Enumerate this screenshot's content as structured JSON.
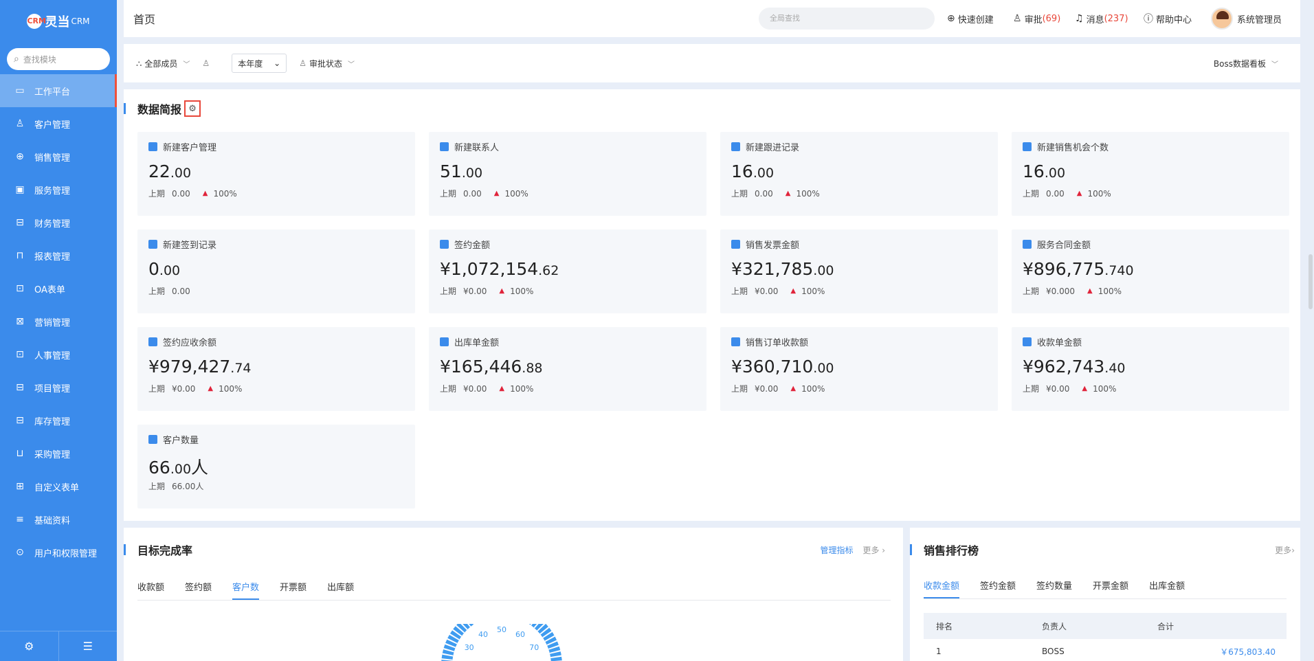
{
  "sidebar": {
    "logo_text": "灵当",
    "logo_suffix": "CRM",
    "logo_mark": "CRM",
    "search_placeholder": "查找模块",
    "items": [
      {
        "label": "工作平台",
        "icon": "monitor-icon",
        "glyph": "▭",
        "active": true
      },
      {
        "label": "客户管理",
        "icon": "user-icon",
        "glyph": "♙"
      },
      {
        "label": "销售管理",
        "icon": "target-icon",
        "glyph": "⊕"
      },
      {
        "label": "服务管理",
        "icon": "briefcase-icon",
        "glyph": "▣"
      },
      {
        "label": "财务管理",
        "icon": "wallet-icon",
        "glyph": "⊟"
      },
      {
        "label": "报表管理",
        "icon": "report-icon",
        "glyph": "⊓"
      },
      {
        "label": "OA表单",
        "icon": "stamp-icon",
        "glyph": "⊡"
      },
      {
        "label": "营销管理",
        "icon": "bookmark-icon",
        "glyph": "⊠"
      },
      {
        "label": "人事管理",
        "icon": "person-card-icon",
        "glyph": "⊡"
      },
      {
        "label": "项目管理",
        "icon": "project-icon",
        "glyph": "⊟"
      },
      {
        "label": "库存管理",
        "icon": "warehouse-icon",
        "glyph": "⊟"
      },
      {
        "label": "采购管理",
        "icon": "cart-icon",
        "glyph": "⊔"
      },
      {
        "label": "自定义表单",
        "icon": "grid-icon",
        "glyph": "⊞"
      },
      {
        "label": "基础资料",
        "icon": "document-icon",
        "glyph": "≡"
      },
      {
        "label": "用户和权限管理",
        "icon": "gear-circle-icon",
        "glyph": "⊙"
      }
    ],
    "footer_settings_glyph": "⚙",
    "footer_collapse_glyph": "☰"
  },
  "header": {
    "title": "首页",
    "global_search_placeholder": "全局查找",
    "quick_create": "快速创建",
    "approval": "审批",
    "approval_count": "(69)",
    "messages": "消息",
    "messages_count": "(237)",
    "help": "帮助中心",
    "user_name": "系统管理员"
  },
  "filters": {
    "members": "全部成员",
    "period": "本年度",
    "approval_status": "审批状态",
    "dashboard": "Boss数据看板"
  },
  "brief": {
    "title": "数据简报",
    "prev_label": "上期",
    "stats": [
      {
        "label": "新建客户管理",
        "int": "22",
        "dec": ".00",
        "unit": "",
        "prev": "0.00",
        "pct": "100%",
        "icon_color": "#3b8beb"
      },
      {
        "label": "新建联系人",
        "int": "51",
        "dec": ".00",
        "unit": "",
        "prev": "0.00",
        "pct": "100%",
        "icon_color": "#3b8beb"
      },
      {
        "label": "新建跟进记录",
        "int": "16",
        "dec": ".00",
        "unit": "",
        "prev": "0.00",
        "pct": "100%",
        "icon_color": "#3b8beb"
      },
      {
        "label": "新建销售机会个数",
        "int": "16",
        "dec": ".00",
        "unit": "",
        "prev": "0.00",
        "pct": "100%",
        "icon_color": "#3b8beb"
      },
      {
        "label": "新建签到记录",
        "int": "0",
        "dec": ".00",
        "unit": "",
        "prev": "0.00",
        "pct": "",
        "icon_color": "#3b8beb"
      },
      {
        "label": "签约金额",
        "int": "¥1,072,154",
        "dec": ".62",
        "unit": "",
        "prev": "¥0.00",
        "pct": "100%",
        "icon_color": "#3b8beb"
      },
      {
        "label": "销售发票金额",
        "int": "¥321,785",
        "dec": ".00",
        "unit": "",
        "prev": "¥0.00",
        "pct": "100%",
        "icon_color": "#3b8beb"
      },
      {
        "label": "服务合同金额",
        "int": "¥896,775",
        "dec": ".740",
        "unit": "",
        "prev": "¥0.000",
        "pct": "100%",
        "icon_color": "#3b8beb"
      },
      {
        "label": "签约应收余额",
        "int": "¥979,427",
        "dec": ".74",
        "unit": "",
        "prev": "¥0.00",
        "pct": "100%",
        "icon_color": "#3b8beb"
      },
      {
        "label": "出库单金额",
        "int": "¥165,446",
        "dec": ".88",
        "unit": "",
        "prev": "¥0.00",
        "pct": "100%",
        "icon_color": "#3b8beb"
      },
      {
        "label": "销售订单收款额",
        "int": "¥360,710",
        "dec": ".00",
        "unit": "",
        "prev": "¥0.00",
        "pct": "100%",
        "icon_color": "#3b8beb"
      },
      {
        "label": "收款单金额",
        "int": "¥962,743",
        "dec": ".40",
        "unit": "",
        "prev": "¥0.00",
        "pct": "100%",
        "icon_color": "#3b8beb"
      },
      {
        "label": "客户数量",
        "int": "66",
        "dec": ".00",
        "unit": "人",
        "prev": "66.00人",
        "pct": "",
        "icon_color": "#3b8beb"
      }
    ]
  },
  "goal": {
    "title": "目标完成率",
    "manage_label": "管理指标",
    "more_label": "更多",
    "tabs": [
      "收款额",
      "签约额",
      "客户数",
      "开票额",
      "出库额"
    ],
    "active_tab": 2,
    "gauge_ticks": [
      "30",
      "40",
      "50",
      "60",
      "70"
    ]
  },
  "rank": {
    "title": "销售排行榜",
    "more_label": "更多",
    "tabs": [
      "收款金额",
      "签约金额",
      "签约数量",
      "开票金额",
      "出库金额"
    ],
    "active_tab": 0,
    "columns": [
      "排名",
      "负责人",
      "合计"
    ],
    "rows": [
      {
        "rank": "1",
        "owner": "BOSS",
        "total": "￥675,803.40"
      }
    ]
  }
}
